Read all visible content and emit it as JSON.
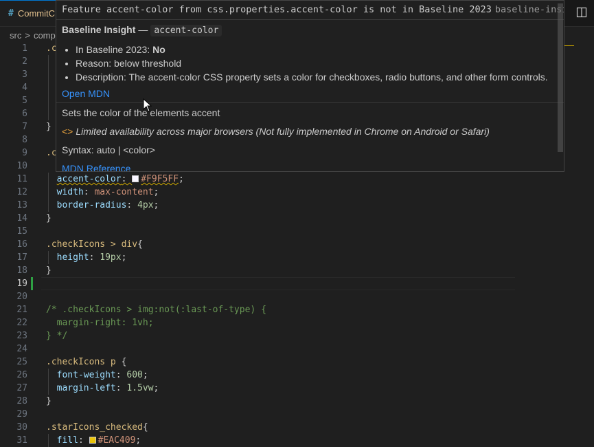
{
  "tab": {
    "icon": "hash-icon",
    "title": "CommitC"
  },
  "breadcrumb": {
    "root": "src",
    "separator": ">",
    "segment": "compo"
  },
  "editor": {
    "lines": [
      {
        "n": "1",
        "tokens": [
          {
            "t": ".c",
            "c": "sel"
          }
        ]
      },
      {
        "n": "2",
        "tokens": []
      },
      {
        "n": "3",
        "tokens": []
      },
      {
        "n": "4",
        "tokens": []
      },
      {
        "n": "5",
        "tokens": []
      },
      {
        "n": "6",
        "tokens": []
      },
      {
        "n": "7",
        "tokens": [
          {
            "t": "}",
            "c": "punc"
          }
        ]
      },
      {
        "n": "8",
        "tokens": []
      },
      {
        "n": "9",
        "tokens": [
          {
            "t": ".c",
            "c": "sel"
          }
        ]
      },
      {
        "n": "10",
        "tokens": []
      },
      {
        "n": "11",
        "tokens": [
          {
            "t": "  "
          },
          {
            "t": "accent-color",
            "c": "prop squiggle"
          },
          {
            "t": ": ",
            "c": "punc squiggle"
          },
          {
            "swatch": "#F9F5FF"
          },
          {
            "t": "#F9F5FF",
            "c": "val squiggle"
          },
          {
            "t": ";",
            "c": "punc"
          }
        ]
      },
      {
        "n": "12",
        "tokens": [
          {
            "t": "  "
          },
          {
            "t": "width",
            "c": "prop"
          },
          {
            "t": ": ",
            "c": "punc"
          },
          {
            "t": "max-content",
            "c": "val"
          },
          {
            "t": ";",
            "c": "punc"
          }
        ]
      },
      {
        "n": "13",
        "tokens": [
          {
            "t": "  "
          },
          {
            "t": "border-radius",
            "c": "prop"
          },
          {
            "t": ": ",
            "c": "punc"
          },
          {
            "t": "4px",
            "c": "num"
          },
          {
            "t": ";",
            "c": "punc"
          }
        ]
      },
      {
        "n": "14",
        "tokens": [
          {
            "t": "}",
            "c": "punc"
          }
        ]
      },
      {
        "n": "15",
        "tokens": []
      },
      {
        "n": "16",
        "tokens": [
          {
            "t": ".checkIcons > div",
            "c": "sel"
          },
          {
            "t": "{",
            "c": "punc"
          }
        ]
      },
      {
        "n": "17",
        "tokens": [
          {
            "t": "  "
          },
          {
            "t": "height",
            "c": "prop"
          },
          {
            "t": ": ",
            "c": "punc"
          },
          {
            "t": "19px",
            "c": "num"
          },
          {
            "t": ";",
            "c": "punc"
          }
        ]
      },
      {
        "n": "18",
        "tokens": [
          {
            "t": "}",
            "c": "punc"
          }
        ]
      },
      {
        "n": "19",
        "tokens": [],
        "active": true
      },
      {
        "n": "20",
        "tokens": []
      },
      {
        "n": "21",
        "tokens": [
          {
            "t": "/* .checkIcons > img:not(:last-of-type) {",
            "c": "cmt"
          }
        ]
      },
      {
        "n": "22",
        "tokens": [
          {
            "t": "  margin-right: 1vh;",
            "c": "cmt"
          }
        ]
      },
      {
        "n": "23",
        "tokens": [
          {
            "t": "} */",
            "c": "cmt"
          }
        ]
      },
      {
        "n": "24",
        "tokens": []
      },
      {
        "n": "25",
        "tokens": [
          {
            "t": ".checkIcons p ",
            "c": "sel"
          },
          {
            "t": "{",
            "c": "punc"
          }
        ]
      },
      {
        "n": "26",
        "tokens": [
          {
            "t": "  "
          },
          {
            "t": "font-weight",
            "c": "prop"
          },
          {
            "t": ": ",
            "c": "punc"
          },
          {
            "t": "600",
            "c": "num"
          },
          {
            "t": ";",
            "c": "punc"
          }
        ]
      },
      {
        "n": "27",
        "tokens": [
          {
            "t": "  "
          },
          {
            "t": "margin-left",
            "c": "prop"
          },
          {
            "t": ": ",
            "c": "punc"
          },
          {
            "t": "1.5vw",
            "c": "num"
          },
          {
            "t": ";",
            "c": "punc"
          }
        ]
      },
      {
        "n": "28",
        "tokens": [
          {
            "t": "}",
            "c": "punc"
          }
        ]
      },
      {
        "n": "29",
        "tokens": []
      },
      {
        "n": "30",
        "tokens": [
          {
            "t": ".starIcons_checked",
            "c": "sel"
          },
          {
            "t": "{",
            "c": "punc"
          }
        ]
      },
      {
        "n": "31",
        "tokens": [
          {
            "t": "  "
          },
          {
            "t": "fill",
            "c": "prop"
          },
          {
            "t": ": ",
            "c": "punc"
          },
          {
            "swatch": "#EAC409"
          },
          {
            "t": "#EAC409",
            "c": "val"
          },
          {
            "t": ";",
            "c": "punc"
          }
        ]
      }
    ]
  },
  "hover": {
    "diagnostic": "Feature accent-color from css.properties.accent-color is not in Baseline 2023",
    "diagnostic_source": "baseline-insight",
    "title": "Baseline Insight",
    "title_dash": "—",
    "feature_chip": "accent-color",
    "bullets": [
      {
        "label": "In Baseline 2023: ",
        "value": "No",
        "bold": true
      },
      {
        "label": "Reason: below threshold",
        "value": ""
      },
      {
        "label": "Description: The accent-color CSS property sets a color for checkboxes, radio buttons, and other form controls.",
        "value": ""
      }
    ],
    "open_mdn": "Open MDN",
    "summary": "Sets the color of the elements accent",
    "availability_icon": "limited-availability-icon",
    "availability": "Limited availability across major browsers (Not fully implemented in Chrome on Android or Safari)",
    "syntax": "Syntax: auto | <color>",
    "mdn_reference": "MDN Reference"
  },
  "colors": {
    "accent": "#0078d4",
    "link": "#3794ff",
    "warning": "#cca700"
  }
}
